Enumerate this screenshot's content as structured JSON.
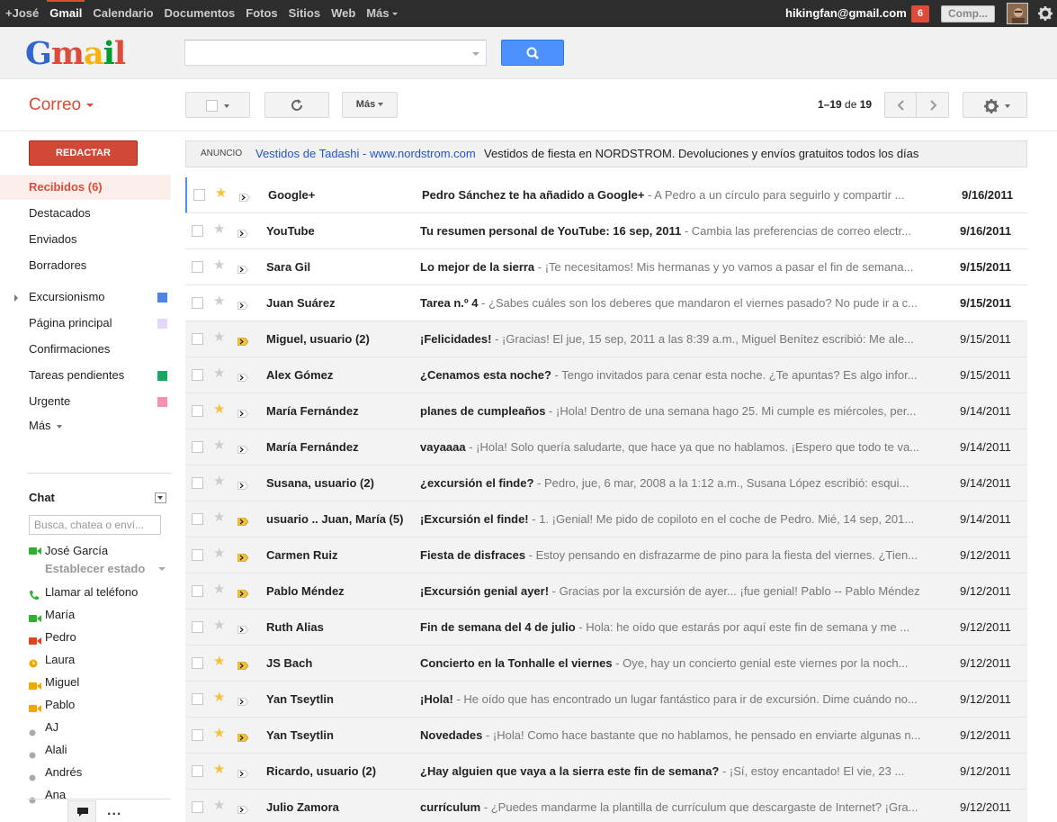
{
  "topbar": {
    "nav": [
      {
        "label": "+José",
        "active": false
      },
      {
        "label": "Gmail",
        "active": true
      },
      {
        "label": "Calendario",
        "active": false
      },
      {
        "label": "Documentos",
        "active": false
      },
      {
        "label": "Fotos",
        "active": false
      },
      {
        "label": "Sitios",
        "active": false
      },
      {
        "label": "Web",
        "active": false
      },
      {
        "label": "Más",
        "active": false
      }
    ],
    "email": "hikingfan@gmail.com",
    "notifications": "6",
    "share_label": "Comp...",
    "accent": "#dd4b39"
  },
  "logo": {
    "text": "Gmail"
  },
  "search": {
    "placeholder": "",
    "button_icon": "search-icon",
    "button_color": "#4d90fe"
  },
  "toolbar": {
    "mail_label": "Correo",
    "more_label": "Más",
    "paging": {
      "range": "1–19",
      "of": "de",
      "total": "19"
    }
  },
  "compose_label": "REDACTAR",
  "sidebar": {
    "items": [
      {
        "label": "Recibidos (6)",
        "active": true
      },
      {
        "label": "Destacados"
      },
      {
        "label": "Enviados"
      },
      {
        "label": "Borradores"
      },
      {
        "label": "Excursionismo",
        "color": "#4a86e8",
        "expandable": true
      },
      {
        "label": "Página principal",
        "color": "#e3d7ff"
      },
      {
        "label": "Confirmaciones"
      },
      {
        "label": "Tareas pendientes",
        "color": "#16a765"
      },
      {
        "label": "Urgente",
        "color": "#f691b2"
      },
      {
        "label": "Más",
        "caret": true
      }
    ]
  },
  "chat": {
    "title": "Chat",
    "search_placeholder": "Busca, chatea o enví...",
    "me": {
      "name": "José García",
      "status": "Establecer estado"
    },
    "contacts": [
      {
        "name": "Llamar al teléfono",
        "icon": "phone-icon"
      },
      {
        "name": "María",
        "icon": "video-green-icon"
      },
      {
        "name": "Pedro",
        "icon": "video-red-icon"
      },
      {
        "name": "Laura",
        "icon": "idle-icon"
      },
      {
        "name": "Miguel",
        "icon": "video-orange-icon"
      },
      {
        "name": "Pablo",
        "icon": "video-orange-icon"
      },
      {
        "name": "AJ",
        "icon": "offline-icon"
      },
      {
        "name": "Alali",
        "icon": "offline-icon"
      },
      {
        "name": "Andrés",
        "icon": "offline-icon"
      },
      {
        "name": "Ana",
        "icon": "offline-icon"
      }
    ],
    "more": "..."
  },
  "ad": {
    "label": "ANUNCIO",
    "link": "Vestidos de Tadashi - www.nordstrom.com",
    "text": "Vestidos de fiesta en NORDSTROM. Devoluciones y envíos gratuitos todos los días"
  },
  "messages": [
    {
      "sender": "Google+",
      "subject": "Pedro Sánchez te ha añadido a Google+",
      "snippet": " - A Pedro a un círculo para seguirlo y compartir ...",
      "date": "9/16/2011",
      "unread": true,
      "starred": true,
      "important": false
    },
    {
      "sender": "YouTube",
      "subject": "Tu resumen personal de YouTube: 16 sep, 2011",
      "snippet": " - Cambia las preferencias de correo electr...",
      "date": "9/16/2011",
      "unread": true,
      "starred": false,
      "important": false
    },
    {
      "sender": "Sara Gil",
      "subject": "Lo mejor de la sierra",
      "snippet": " - ¡Te necesitamos! Mis hermanas y yo vamos a pasar el fin de semana...",
      "date": "9/15/2011",
      "unread": true,
      "starred": false,
      "important": false
    },
    {
      "sender": "Juan Suárez",
      "subject": "Tarea n.º 4",
      "snippet": " - ¿Sabes cuáles son los deberes que mandaron el viernes pasado? No pude ir a c...",
      "date": "9/15/2011",
      "unread": true,
      "starred": false,
      "important": false
    },
    {
      "sender": "Miguel, usuario (2)",
      "subject": "¡Felicidades!",
      "snippet": " - ¡Gracias! El jue, 15 sep, 2011 a las 8:39 a.m., Miguel Benítez escribió: Me ale...",
      "date": "9/15/2011",
      "unread": false,
      "starred": false,
      "important": true
    },
    {
      "sender": "Alex Gómez",
      "subject": "¿Cenamos esta noche?",
      "snippet": " - Tengo invitados para cenar esta noche. ¿Te apuntas? Es algo infor...",
      "date": "9/15/2011",
      "unread": false,
      "starred": false,
      "important": false
    },
    {
      "sender": "María Fernández",
      "subject": "planes de cumpleaños",
      "snippet": " - ¡Hola! Dentro de una semana hago 25. Mi cumple es miércoles, per...",
      "date": "9/14/2011",
      "unread": false,
      "starred": true,
      "important": false
    },
    {
      "sender": "María Fernández",
      "subject": "vayaaaa",
      "snippet": " - ¡Hola! Solo quería saludarte, que hace ya que no hablamos. ¡Espero que todo te va...",
      "date": "9/14/2011",
      "unread": false,
      "starred": false,
      "important": false
    },
    {
      "sender": "Susana, usuario (2)",
      "subject": "¿excursión el finde?",
      "snippet": " - Pedro, jue, 6 mar, 2008 a la 1:12 a.m., Susana López escribió: esqui...",
      "date": "9/14/2011",
      "unread": false,
      "starred": false,
      "important": false
    },
    {
      "sender": "usuario .. Juan, María (5)",
      "subject": "¡Excursión el finde!",
      "snippet": " - 1. ¡Genial! Me pido de copiloto en el coche de Pedro. Mié, 14 sep, 201...",
      "date": "9/14/2011",
      "unread": false,
      "starred": false,
      "important": true
    },
    {
      "sender": "Carmen Ruiz",
      "subject": "Fiesta de disfraces",
      "snippet": " - Estoy pensando en disfrazarme de pino para la fiesta del viernes. ¿Tien...",
      "date": "9/12/2011",
      "unread": false,
      "starred": false,
      "important": true
    },
    {
      "sender": "Pablo Méndez",
      "subject": "¡Excursión genial ayer!",
      "snippet": " - Gracias por la excursión de ayer... ¡fue genial! Pablo -- Pablo Méndez",
      "date": "9/12/2011",
      "unread": false,
      "starred": false,
      "important": true
    },
    {
      "sender": "Ruth Alias",
      "subject": "Fin de semana del 4 de julio",
      "snippet": " - Hola: he oído que estarás por aquí este fin de semana y me ...",
      "date": "9/12/2011",
      "unread": false,
      "starred": false,
      "important": false
    },
    {
      "sender": "JS Bach",
      "subject": "Concierto en la Tonhalle el viernes",
      "snippet": " - Oye, hay un concierto genial este viernes por la noch...",
      "date": "9/12/2011",
      "unread": false,
      "starred": true,
      "important": true
    },
    {
      "sender": "Yan Tseytlin",
      "subject": "¡Hola!",
      "snippet": " - He oído que has encontrado un lugar fantástico para ir de excursión. Dime cuándo no...",
      "date": "9/12/2011",
      "unread": false,
      "starred": true,
      "important": false
    },
    {
      "sender": "Yan Tseytlin",
      "subject": "Novedades",
      "snippet": " - ¡Hola! Como hace bastante que no hablamos, he pensado en enviarte algunas n...",
      "date": "9/12/2011",
      "unread": false,
      "starred": true,
      "important": true
    },
    {
      "sender": "Ricardo, usuario (2)",
      "subject": "¿Hay alguien que vaya a la sierra este fin de semana?",
      "snippet": " - ¡Sí, estoy encantado! El vie, 23 ...",
      "date": "9/12/2011",
      "unread": false,
      "starred": true,
      "important": false
    },
    {
      "sender": "Julio Zamora",
      "subject": "currículum",
      "snippet": " - ¿Puedes mandarme la plantilla de currículum que descargaste de Internet? ¡Gra...",
      "date": "9/12/2011",
      "unread": false,
      "starred": false,
      "important": false
    }
  ]
}
